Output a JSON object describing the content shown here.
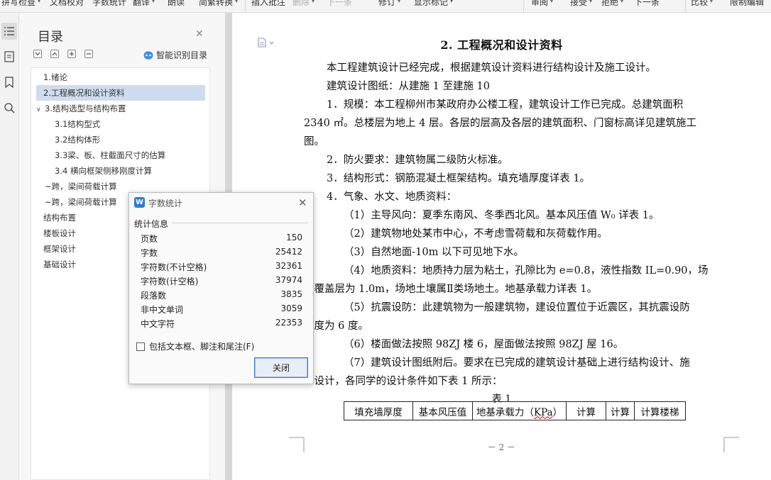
{
  "toolbar": {
    "items": [
      {
        "label": "拼写检查",
        "caret": true
      },
      {
        "label": "文档校对"
      },
      {
        "label": "字数统计"
      },
      {
        "label": "翻译",
        "caret": true
      },
      {
        "label": "朗读"
      },
      {
        "label": "简繁转换",
        "caret": true
      },
      {
        "label": "插入批注"
      },
      {
        "label": "删除",
        "caret": true,
        "disabled": true
      },
      {
        "label": "下一条",
        "disabled": true
      },
      {
        "label": "修订",
        "caret": true
      },
      {
        "label": "显示标记",
        "caret": true
      },
      {
        "label": "审阅",
        "caret": true
      },
      {
        "label": "接受",
        "caret": true
      },
      {
        "label": "拒绝",
        "caret": true
      },
      {
        "label": "下一条"
      },
      {
        "label": "比较",
        "caret": true
      },
      {
        "label": "限制编辑"
      }
    ]
  },
  "toc": {
    "title": "目录",
    "smart_label": "智能识别目录",
    "items": [
      {
        "label": "1.绪论",
        "level": 1
      },
      {
        "label": "2.工程概况和设计资料",
        "level": 1,
        "selected": true
      },
      {
        "label": "3.结构选型与结构布置",
        "level": 1,
        "expandable": true
      },
      {
        "label": "3.1结构型式",
        "level": 2
      },
      {
        "label": "3.2结构体形",
        "level": 2
      },
      {
        "label": "3.3梁、板、柱截面尺寸的估算",
        "level": 2
      },
      {
        "label": "3.4  横向框架侧移刚度计算",
        "level": 2
      },
      {
        "label": "~跨，梁间荷载计算",
        "level": 1.5
      },
      {
        "label": "~跨，梁间荷载计算",
        "level": 1.5
      },
      {
        "label": "结构布置",
        "level": 1
      },
      {
        "label": "楼板设计",
        "level": 1
      },
      {
        "label": "框架设计",
        "level": 1
      },
      {
        "label": "基础设计",
        "level": 1
      }
    ]
  },
  "document": {
    "title": "2. 工程概况和设计资料",
    "paragraphs": [
      "本工程建筑设计已经完成，根据建筑设计资料进行结构设计及施工设计。",
      "建筑设计图纸：从建施 1 至建施 10",
      "1．规模：本工程柳州市某政府办公楼工程，建筑设计工作已完成。总建筑面积",
      "2340 ㎡。总楼层为地上 4 层。各层的层高及各层的建筑面积、门窗标高详见建筑施工",
      "图。",
      "2．防火要求：建筑物属二级防火标准。",
      "3．结构形式：钢筋混凝土框架结构。填充墙厚度详表 1。",
      "4．气象、水文、地质资料：",
      "（1）主导风向：夏季东南风、冬季西北风。基本风压值 W₀ 详表 1。",
      "（2）建筑物地处某市中心，不考虑雪荷载和灰荷载作用。",
      "（3）自然地面-10m 以下可见地下水。",
      "（4）地质资料：地质持力层为粘土，孔隙比为 e=0.8，液性指数 IL=0.90，场",
      "地覆盖层为 1.0m，场地土壤属Ⅱ类场地土。地基承载力详表 1。",
      "（5）抗震设防：此建筑物为一般建筑物，建设位置位于近震区，其抗震设防",
      "烈度为 6 度。",
      "（6）楼面做法按照 98ZJ 楼 6，屋面做法按照 98ZJ 屋 16。",
      "（7）建筑设计图纸附后。要求在已完成的建筑设计基础上进行结构设计、施",
      "工设计，各同学的设计条件如下表 1 所示："
    ],
    "table_caption": "表 1",
    "table_headers": [
      "填充墙厚度",
      "基本风压值",
      "地基承载力（",
      "KPa",
      "）",
      "计算",
      "计算",
      "计算楼梯"
    ],
    "page_number": "－ 2 －"
  },
  "dialog": {
    "title": "字数统计",
    "section_title": "统计信息",
    "stats": [
      {
        "label": "页数",
        "value": "150"
      },
      {
        "label": "字数",
        "value": "25412"
      },
      {
        "label": "字符数(不计空格)",
        "value": "32361"
      },
      {
        "label": "字符数(计空格)",
        "value": "37974"
      },
      {
        "label": "段落数",
        "value": "3835"
      },
      {
        "label": "非中文单词",
        "value": "3059"
      },
      {
        "label": "中文字符",
        "value": "22353"
      }
    ],
    "checkbox_label": "包括文本框、脚注和尾注(F)",
    "close_button": "关闭"
  },
  "colors": {
    "accent": "#3a7bd5",
    "toc_selected": "#cfdcef",
    "logo_blue": "#2e7bd6"
  }
}
